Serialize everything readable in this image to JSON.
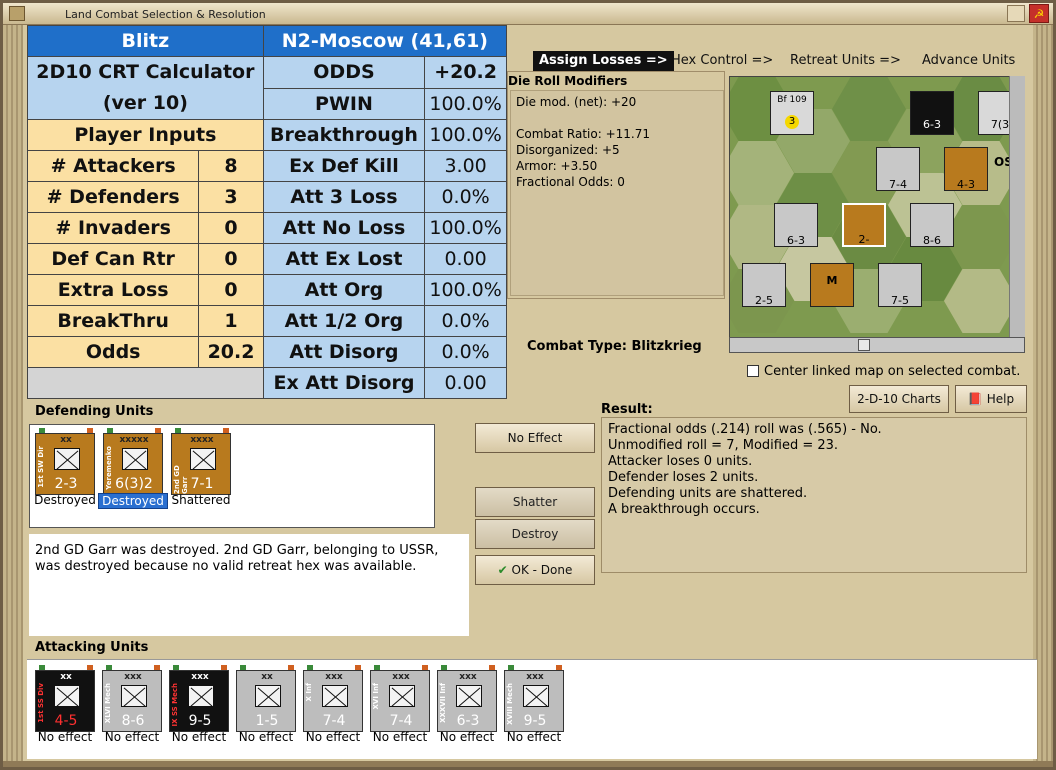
{
  "window": {
    "title": "Land Combat Selection & Resolution"
  },
  "calc": {
    "h1": "Blitz",
    "h2": "N2-Moscow (41,61)",
    "calc_title": "2D10 CRT Calculator",
    "calc_ver": "(ver 10)",
    "inputs_header": "Player Inputs",
    "rows_left": [
      {
        "label": "# Attackers",
        "value": "8"
      },
      {
        "label": "# Defenders",
        "value": "3"
      },
      {
        "label": "# Invaders",
        "value": "0"
      },
      {
        "label": "Def Can Rtr",
        "value": "0"
      },
      {
        "label": "Extra Loss",
        "value": "0"
      },
      {
        "label": "BreakThru",
        "value": "1"
      },
      {
        "label": "Odds",
        "value": "20.2"
      }
    ],
    "rows_right": [
      {
        "label": "ODDS",
        "value": "+20.2"
      },
      {
        "label": "PWIN",
        "value": "100.0%"
      },
      {
        "label": "Breakthrough",
        "value": "100.0%"
      },
      {
        "label": "Ex Def Kill",
        "value": "3.00"
      },
      {
        "label": "Att 3 Loss",
        "value": "0.0%"
      },
      {
        "label": "Att No Loss",
        "value": "100.0%"
      },
      {
        "label": "Att Ex Lost",
        "value": "0.00"
      },
      {
        "label": "Att Org",
        "value": "100.0%"
      },
      {
        "label": "Att 1/2 Org",
        "value": "0.0%"
      },
      {
        "label": "Att Disorg",
        "value": "0.0%"
      },
      {
        "label": "Ex Att Disorg",
        "value": "0.00"
      }
    ]
  },
  "phases": {
    "assign": "Assign Losses =>",
    "hex": "Hex Control =>",
    "retreat": "Retreat Units =>",
    "advance": "Advance Units"
  },
  "modifiers": {
    "title": "Die Roll Modifiers",
    "lines": [
      "Die mod. (net): +20",
      "",
      "Combat Ratio: +11.71",
      "Disorganized: +5",
      "Armor: +3.50",
      "Fractional Odds: 0"
    ]
  },
  "combat_type": "Combat Type:  Blitzkrieg",
  "center_map": "Center linked map on selected combat.",
  "buttons": {
    "charts": "2-D-10 Charts",
    "help": "Help",
    "no_effect": "No Effect",
    "shatter": "Shatter",
    "destroy": "Destroy",
    "ok": "OK - Done"
  },
  "defending": {
    "title": "Defending Units",
    "units": [
      {
        "name": "1st SW Dir",
        "size": "xx",
        "strength": "2-3",
        "status": "Destroyed",
        "color": "#b87a1e"
      },
      {
        "name": "Yeremenko",
        "size": "xxxxx",
        "strength": "6(3)2",
        "status": "Destroyed",
        "color": "#b87a1e"
      },
      {
        "name": "2nd GD Garr",
        "size": "xxxx",
        "strength": "7-1",
        "status": "Shattered",
        "color": "#b87a1e"
      }
    ]
  },
  "message": "2nd GD Garr was destroyed.  2nd GD Garr, belonging to USSR, was destroyed because no valid retreat hex was available.",
  "result": {
    "title": "Result:",
    "lines": [
      "Fractional odds (.214) roll was (.565)  - No.",
      "Unmodified roll = 7, Modified = 23.",
      "Attacker loses 0 units.",
      "Defender loses 2 units.",
      "Defending units are shattered.",
      "A breakthrough occurs."
    ]
  },
  "attacking": {
    "title": "Attacking Units",
    "units": [
      {
        "name": "1st SS Div",
        "size": "xx",
        "strength": "4-5",
        "status": "No effect",
        "color": "#111111"
      },
      {
        "name": "XLVI Mech",
        "size": "xxx",
        "strength": "8-6",
        "status": "No effect",
        "color": "#bdbdbd"
      },
      {
        "name": "IX SS Mech",
        "size": "xxx",
        "strength": "9-5",
        "status": "No effect",
        "color": "#111111"
      },
      {
        "name": "",
        "size": "xx",
        "strength": "1-5",
        "status": "No effect",
        "color": "#bdbdbd"
      },
      {
        "name": "X Inf",
        "size": "xxx",
        "strength": "7-4",
        "status": "No effect",
        "color": "#bdbdbd"
      },
      {
        "name": "XVI Inf",
        "size": "xxx",
        "strength": "7-4",
        "status": "No effect",
        "color": "#bdbdbd"
      },
      {
        "name": "XXXVII Inf",
        "size": "xxx",
        "strength": "6-3",
        "status": "No effect",
        "color": "#bdbdbd"
      },
      {
        "name": "XVIII Mech",
        "size": "xxx",
        "strength": "9-5",
        "status": "No effect",
        "color": "#bdbdbd"
      }
    ]
  },
  "map": {
    "units": [
      {
        "label": "Bf 109",
        "str": "3",
        "color": "#d9d9d9"
      },
      {
        "label": "6-3",
        "str": "6-3",
        "color": "#111111"
      },
      {
        "label": "7(3",
        "str": "7(3",
        "color": "#d9d9d9"
      },
      {
        "label": "7-4",
        "str": "7-4",
        "color": "#c8c8c8"
      },
      {
        "label": "4-3",
        "str": "4-3",
        "color": "#b87a1e"
      },
      {
        "label": "6-3",
        "str": "6-3",
        "color": "#c8c8c8"
      },
      {
        "label": "2-",
        "str": "2-",
        "color": "#b87a1e"
      },
      {
        "label": "8-6",
        "str": "8-6",
        "color": "#c8c8c8"
      },
      {
        "label": "2-5",
        "str": "2-5",
        "color": "#c8c8c8"
      },
      {
        "label": "M",
        "str": "",
        "color": "#b87a1e"
      },
      {
        "label": "7-5",
        "str": "7-5",
        "color": "#c8c8c8"
      }
    ],
    "os": "OS"
  }
}
